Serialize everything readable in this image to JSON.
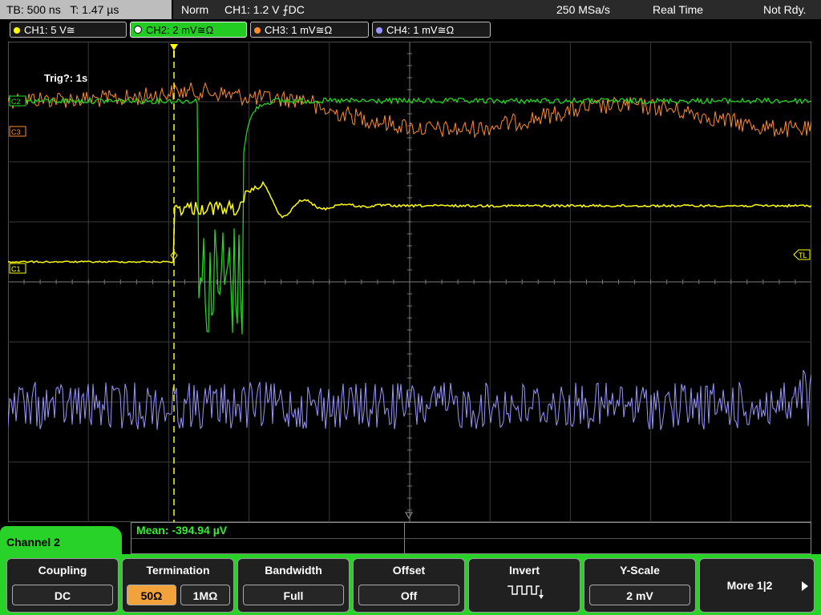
{
  "top": {
    "timebase": "TB: 500 ns",
    "trigger_time": "T: 1.47 µs",
    "mode": "Norm",
    "trigger_info": "CH1: 1.2 V ⨍DC",
    "sample_rate": "250 MSa/s",
    "acq_mode": "Real Time",
    "status": "Not Rdy."
  },
  "channels": [
    {
      "label": "CH1: 5 V≅",
      "color": "#ffff00"
    },
    {
      "label": "CH2: 2 mV≅Ω",
      "color": "#22dd22"
    },
    {
      "label": "CH3: 1 mV≅Ω",
      "color": "#ff8c2a"
    },
    {
      "label": "CH4: 1 mV≅Ω",
      "color": "#9a96ff"
    }
  ],
  "screen": {
    "trig_text": "Trig?: 1s",
    "marker_c3": "C3",
    "marker_c1": "C1",
    "marker_c2": "C2",
    "marker_tl": "TL"
  },
  "measure": {
    "mean": "Mean: -394.94 µV"
  },
  "menu": {
    "channel_title": "Channel 2",
    "coupling_label": "Coupling",
    "coupling_value": "DC",
    "termination_label": "Termination",
    "term_50": "50Ω",
    "term_1m": "1MΩ",
    "bandwidth_label": "Bandwidth",
    "bandwidth_value": "Full",
    "offset_label": "Offset",
    "offset_value": "Off",
    "invert_label": "Invert",
    "yscale_label": "Y-Scale",
    "yscale_value": "2 mV",
    "more_label": "More 1|2"
  }
}
